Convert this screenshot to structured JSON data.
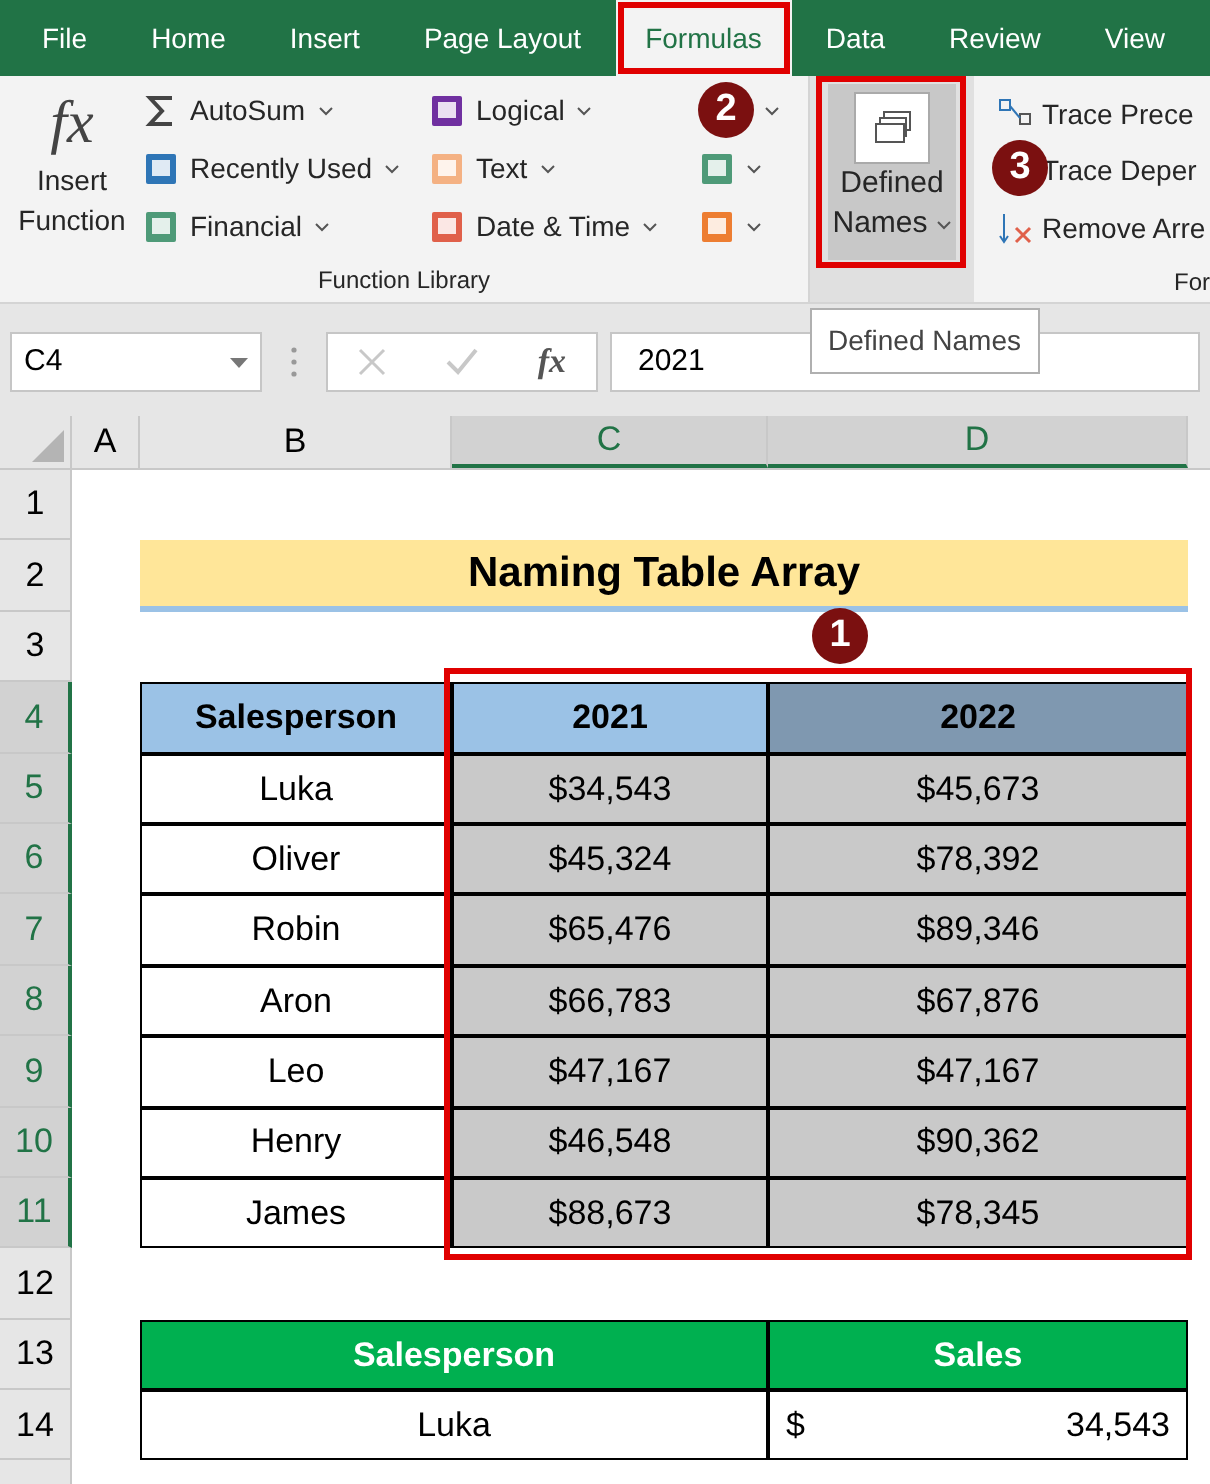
{
  "ribbon": {
    "tabs": [
      {
        "label": "File",
        "selected": false
      },
      {
        "label": "Home",
        "selected": false
      },
      {
        "label": "Insert",
        "selected": false
      },
      {
        "label": "Page Layout",
        "selected": false
      },
      {
        "label": "Formulas",
        "selected": true
      },
      {
        "label": "Data",
        "selected": false
      },
      {
        "label": "Review",
        "selected": false
      },
      {
        "label": "View",
        "selected": false
      }
    ],
    "insert_function": {
      "icon_text": "fx",
      "label": "Insert Function"
    },
    "function_library": {
      "label": "Function Library",
      "columns": [
        [
          {
            "label": "AutoSum",
            "kind": "sigma"
          },
          {
            "label": "Recently Used",
            "kind": "book",
            "color": "#2e75b6"
          },
          {
            "label": "Financial",
            "kind": "book",
            "color": "#4e9a78"
          }
        ],
        [
          {
            "label": "Logical",
            "kind": "book",
            "color": "#7030a0"
          },
          {
            "label": "Text",
            "kind": "book",
            "color": "#f4b183"
          },
          {
            "label": "Date & Time",
            "kind": "book",
            "color": "#e0604a"
          }
        ],
        [
          {
            "kind": "covered"
          },
          {
            "kind": "book",
            "color": "#4e9a78"
          },
          {
            "kind": "book",
            "color": "#ed7d31"
          }
        ]
      ]
    },
    "defined_names": {
      "label_line_1": "Defined",
      "label_line_2": "Names"
    },
    "formula_auditing": {
      "label": "For",
      "items": [
        {
          "label": "Trace Prece",
          "kind": "precedents"
        },
        {
          "label": "Trace Deper",
          "kind": "covered"
        },
        {
          "label": "Remove Arre",
          "kind": "remove"
        }
      ]
    }
  },
  "tooltip": "Defined Names",
  "formula_bar": {
    "name_box": "C4",
    "value": "2021",
    "fx": "fx"
  },
  "columns": [
    {
      "label": "A",
      "selected": false
    },
    {
      "label": "B",
      "selected": false
    },
    {
      "label": "C",
      "selected": true
    },
    {
      "label": "D",
      "selected": true
    }
  ],
  "row_numbers": [
    {
      "label": "1",
      "selected": false
    },
    {
      "label": "2",
      "selected": false
    },
    {
      "label": "3",
      "selected": false
    },
    {
      "label": "4",
      "selected": true
    },
    {
      "label": "5",
      "selected": true
    },
    {
      "label": "6",
      "selected": true
    },
    {
      "label": "7",
      "selected": true
    },
    {
      "label": "8",
      "selected": true
    },
    {
      "label": "9",
      "selected": true
    },
    {
      "label": "10",
      "selected": true
    },
    {
      "label": "11",
      "selected": true
    },
    {
      "label": "12",
      "selected": false
    },
    {
      "label": "13",
      "selected": false
    },
    {
      "label": "14",
      "selected": false
    }
  ],
  "title": "Naming Table Array",
  "sales_table": {
    "headers": [
      "Salesperson",
      "2021",
      "2022"
    ],
    "rows": [
      {
        "name": "Luka",
        "y2021": "$34,543",
        "y2022": "$45,673"
      },
      {
        "name": "Oliver",
        "y2021": "$45,324",
        "y2022": "$78,392"
      },
      {
        "name": "Robin",
        "y2021": "$65,476",
        "y2022": "$89,346"
      },
      {
        "name": "Aron",
        "y2021": "$66,783",
        "y2022": "$67,876"
      },
      {
        "name": "Leo",
        "y2021": "$47,167",
        "y2022": "$47,167"
      },
      {
        "name": "Henry",
        "y2021": "$46,548",
        "y2022": "$90,362"
      },
      {
        "name": "James",
        "y2021": "$88,673",
        "y2022": "$78,345"
      }
    ]
  },
  "lookup_table": {
    "headers": [
      "Salesperson",
      "Sales"
    ],
    "name": "Luka",
    "currency": "$",
    "sales": "34,543"
  },
  "step_badges": [
    "1",
    "2",
    "3"
  ]
}
